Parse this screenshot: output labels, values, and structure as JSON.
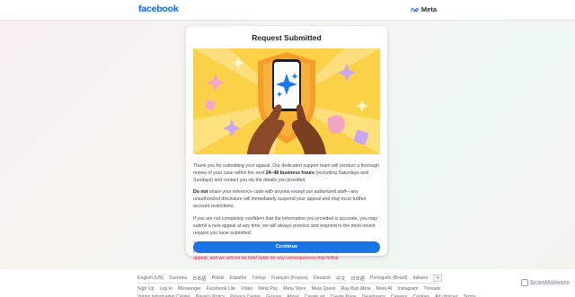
{
  "header": {
    "logo_text": "facebook",
    "meta_text": "Meta"
  },
  "card": {
    "title": "Request Submitted",
    "p1_before": "Thank you for submitting your appeal. Our dedicated support team will conduct a thorough review of your case within the next ",
    "p1_bold": "24–48 business hours",
    "p1_after": " (excluding Saturdays and Sundays) and contact you via the details you provided.",
    "p2_bold": "Do not",
    "p2_after": " share your reference code with anyone except our authorized staff—any unauthorized disclosure will immediately suspend your appeal and may incur further account restrictions.",
    "p3": "If you are not completely confident that the information you provided is accurate, you may submit a new appeal at any time; we will always process and respond to the most recent request you have submitted.",
    "p4": "You are solely responsible for the accuracy and completeness of the information you provide. Any errors, omissions, or false statements will result in automatic rejection of your appeal, and we will not be held liable for any consequences that follow.",
    "continue_label": "Continue"
  },
  "footer": {
    "languages": [
      "English (US)",
      "Svenska",
      "日本語",
      "Polski",
      "Español",
      "Türkçe",
      "Français (France)",
      "Deutsch",
      "中文",
      "日本語",
      "Português (Brasil)",
      "Italiano"
    ],
    "add_label": "+",
    "links": [
      "Sign Up",
      "Log In",
      "Messenger",
      "Facebook Lite",
      "Video",
      "Meta Pay",
      "Meta Store",
      "Meta Quest",
      "Ray-Ban Meta",
      "Meta AI",
      "Instagram",
      "Threads"
    ],
    "links2": [
      "Voting Information Center",
      "Privacy Policy",
      "Privacy Center",
      "Groups",
      "About",
      "Create ad",
      "Create Page",
      "Developers",
      "Careers",
      "Cookies",
      "Ad choices",
      "Terms"
    ]
  },
  "watermark": {
    "text": "ScanMalware"
  },
  "colors": {
    "brand_blue": "#0866ff",
    "button_blue": "#1b74e4",
    "warning_red": "#e41e3f",
    "hero_yellow": "#fbd148"
  }
}
